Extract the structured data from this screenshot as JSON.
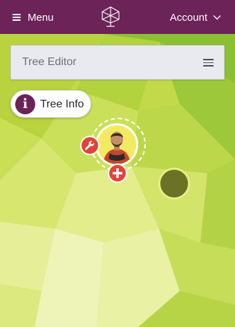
{
  "topbar": {
    "menu_label": "Menu",
    "account_label": "Account",
    "background": "#6b2358"
  },
  "editor": {
    "title": "Tree Editor"
  },
  "tree_info": {
    "label": "Tree Info",
    "icon_glyph": "i"
  },
  "icons": {
    "menu": "hamburger-icon",
    "logo": "tree-logo-icon",
    "account": "chevron-down-icon",
    "editor_menu": "hamburger-icon",
    "info": "info-icon",
    "edit": "wrench-icon",
    "add": "plus-icon"
  },
  "colors": {
    "accent": "#6b2358",
    "action": "#e0443a",
    "background": "#c4dc4c",
    "empty_node": "#6a7226"
  }
}
